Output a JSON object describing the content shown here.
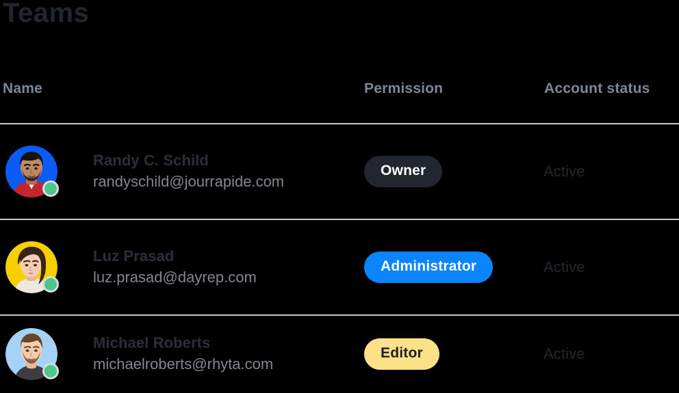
{
  "header": {
    "title": "Teams"
  },
  "table": {
    "columns": [
      {
        "key": "name",
        "label": "Name"
      },
      {
        "key": "permission",
        "label": "Permission"
      },
      {
        "key": "status",
        "label": "Account status"
      }
    ],
    "rows": [
      {
        "name": "Randy C. Schild",
        "email": "randyschild@jourrapide.com",
        "permission": "Owner",
        "permission_style": "owner",
        "permission_bg": "#22262e",
        "permission_fg": "#ffffff",
        "status": "Active",
        "presence": "online",
        "presence_color": "#4ec68a",
        "avatar_bg": "#0a5cf5",
        "avatar_alt": "photo of Randy C. Schild"
      },
      {
        "name": "Luz Prasad",
        "email": "luz.prasad@dayrep.com",
        "permission": "Administrator",
        "permission_style": "administrator",
        "permission_bg": "#0a84ff",
        "permission_fg": "#ffffff",
        "status": "Active",
        "presence": "online",
        "presence_color": "#4ec68a",
        "avatar_bg": "#f5cf00",
        "avatar_alt": "photo of Luz Prasad"
      },
      {
        "name": "Michael Roberts",
        "email": "michaelroberts@rhyta.com",
        "permission": "Editor",
        "permission_style": "editor",
        "permission_bg": "#fbe288",
        "permission_fg": "#1c1f26",
        "status": "Active",
        "presence": "online",
        "presence_color": "#4ec68a",
        "avatar_bg": "#a5d3f7",
        "avatar_alt": "photo of Michael Roberts"
      }
    ]
  },
  "theme": {
    "background": "#000000",
    "title_color": "#22262e",
    "header_color": "#7d8896",
    "name_color": "#2a2f39",
    "email_color": "#82868f",
    "status_color": "#23262d",
    "divider_color": "#c6c7cb"
  }
}
